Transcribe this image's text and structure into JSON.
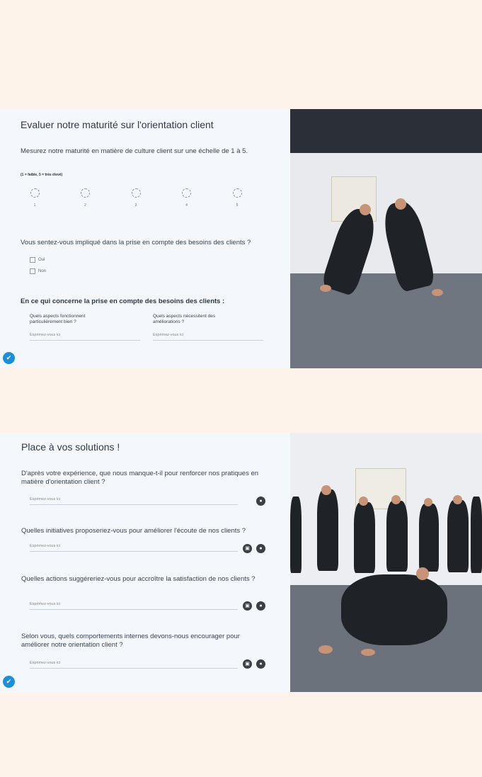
{
  "card1": {
    "title": "Evaluer notre maturité sur l'orientation client",
    "q1": "Mesurez notre maturité en matière de culture client sur une échelle de 1 à 5.",
    "scale_hint": "(1 = faible, 5 = très élevé)",
    "scale": [
      "1",
      "2",
      "3",
      "4",
      "5"
    ],
    "q2": "Vous sentez-vous impliqué dans la prise en compte des besoins des clients ?",
    "options": [
      "Oui",
      "Non"
    ],
    "section_title": "En ce qui concerne la prise en compte des besoins des clients :",
    "sub1": "Quels aspects fonctionnent particulièrement bien ?",
    "sub2": "Quels aspects nécessitent des améliorations ?",
    "placeholder": "Exprimez-vous ici"
  },
  "card2": {
    "title": "Place à vos solutions !",
    "questions": [
      "D'après votre expérience, que nous manque-t-il pour renforcer nos pratiques en matière d'orientation client ?",
      "Quelles initiatives proposeriez-vous pour améliorer l'écoute de nos clients ?",
      "Quelles actions suggéreriez-vous pour accroître la satisfaction de nos clients ?",
      "Selon vous, quels comportements internes devons-nous encourager pour améliorer notre orientation client ?"
    ],
    "placeholder": "Exprimez-vous ici"
  },
  "icons": {
    "fab": "edit-check-icon",
    "mic": "microphone-icon",
    "camera": "camera-icon"
  }
}
